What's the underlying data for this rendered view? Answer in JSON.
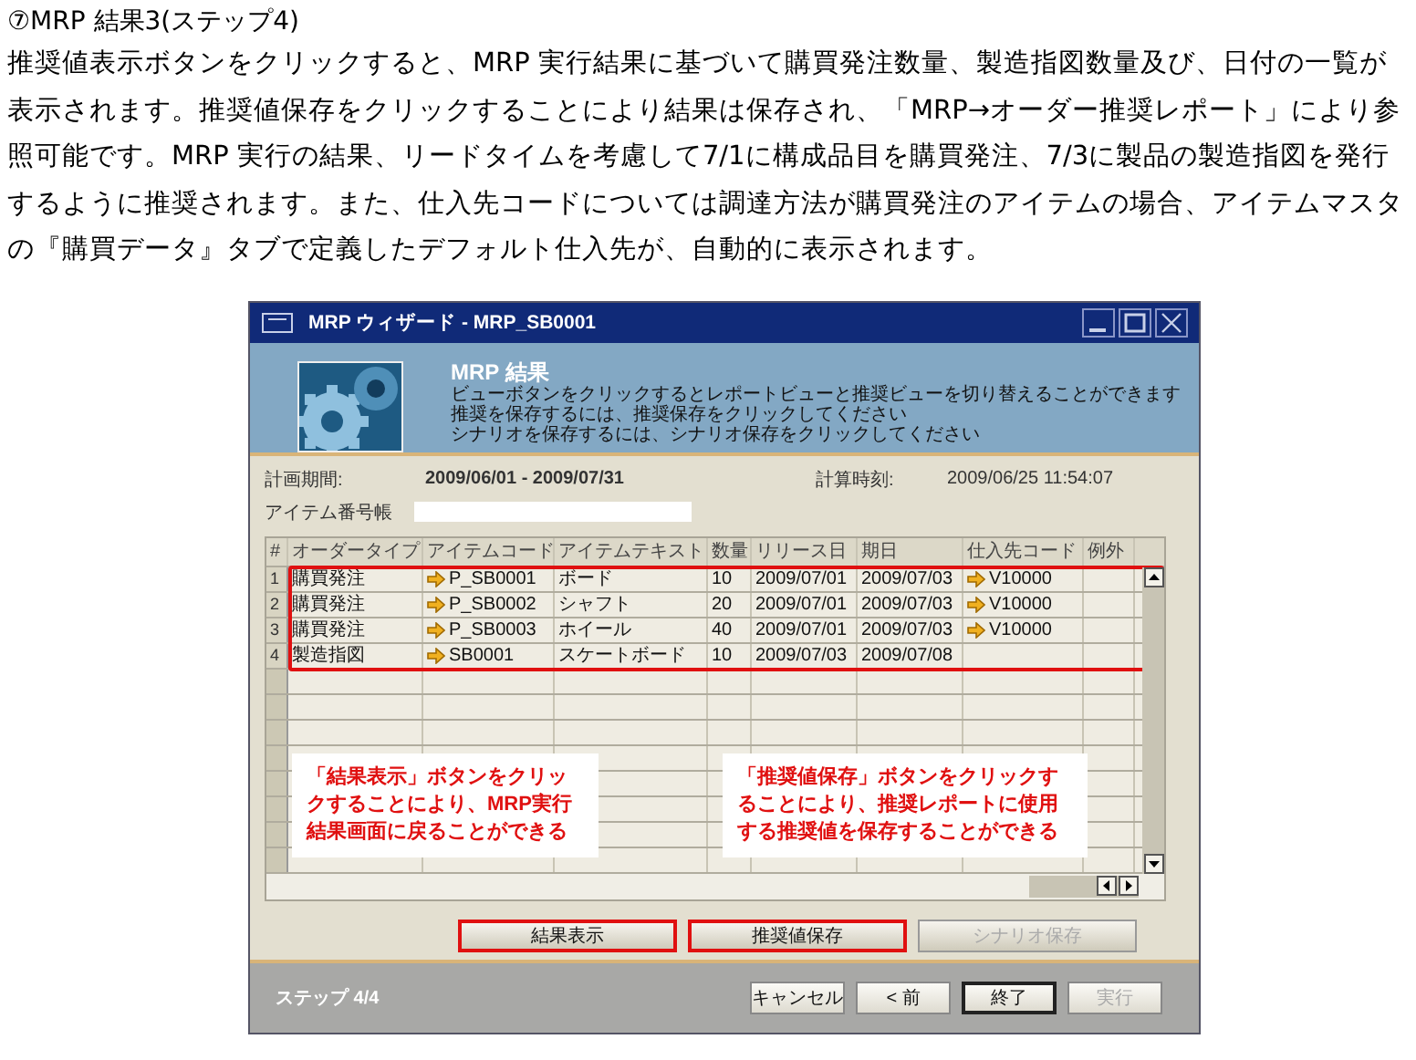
{
  "heading": "⑦MRP 結果3(ステップ4)",
  "paragraph": "推奨値表示ボタンをクリックすると、MRP 実行結果に基づいて購買発注数量、製造指図数量及び、日付の一覧が表示されます。推奨値保存をクリックすることにより結果は保存され、「MRP→オーダー推奨レポート」により参照可能です。MRP 実行の結果、リードタイムを考慮して7/1に構成品目を購買発注、7/3に製品の製造指図を発行するように推奨されます。また、仕入先コードについては調達方法が購買発注のアイテムの場合、アイテムマスタの『購買データ』タブで定義したデフォルト仕入先が、自動的に表示されます。",
  "window": {
    "title": "MRP ウィザード - MRP_SB0001",
    "banner": {
      "title": "MRP 結果",
      "lines": [
        "ビューボタンをクリックするとレポートビューと推奨ビューを切り替えることができます",
        "推奨を保存するには、推奨保存をクリックしてください",
        "シナリオを保存するには、シナリオ保存をクリックしてください"
      ]
    },
    "period_label": "計画期間:",
    "period": "2009/06/01 - 2009/07/31",
    "calc_label": "計算時刻:",
    "calc_time": "2009/06/25 11:54:07",
    "item_label": "アイテム番号帳",
    "table": {
      "columns": [
        "#",
        "オーダータイプ",
        "アイテムコード",
        "アイテムテキスト",
        "数量",
        "リリース日",
        "期日",
        "仕入先コード",
        "例外"
      ],
      "highlighted": true,
      "rows": [
        {
          "number": "1",
          "order_type": "購買発注",
          "item_code": "P_SB0001",
          "item_text": "ボード",
          "quantity": "10",
          "release_date": "2009/07/01",
          "due_date": "2009/07/03",
          "vendor_code": "V10000"
        },
        {
          "number": "2",
          "order_type": "購買発注",
          "item_code": "P_SB0002",
          "item_text": "シャフト",
          "quantity": "20",
          "release_date": "2009/07/01",
          "due_date": "2009/07/03",
          "vendor_code": "V10000"
        },
        {
          "number": "3",
          "order_type": "購買発注",
          "item_code": "P_SB0003",
          "item_text": "ホイール",
          "quantity": "40",
          "release_date": "2009/07/01",
          "due_date": "2009/07/03",
          "vendor_code": "V10000"
        },
        {
          "number": "4",
          "order_type": "製造指図",
          "item_code": "SB0001",
          "item_text": "スケートボード",
          "quantity": "10",
          "release_date": "2009/07/03",
          "due_date": "2009/07/08"
        }
      ]
    },
    "callouts": [
      "「結果表示」ボタンをクリックすることにより、MRP実行結果画面に戻ることができる",
      "「推奨値保存」ボタンをクリックすることにより、推奨レポートに使用する推奨値を保存することができる"
    ],
    "actions": [
      {
        "label": "結果表示",
        "highlighted": true,
        "disabled": false
      },
      {
        "label": "推奨値保存",
        "highlighted": true,
        "disabled": false
      },
      {
        "label": "シナリオ保存",
        "highlighted": false,
        "disabled": true
      }
    ],
    "step": "ステップ 4/4",
    "nav": [
      {
        "label": "キャンセル",
        "default": false,
        "disabled": false
      },
      {
        "label": "< 前",
        "default": false,
        "disabled": false
      },
      {
        "label": "終了",
        "default": true,
        "disabled": false
      },
      {
        "label": "実行",
        "default": false,
        "disabled": true
      }
    ]
  }
}
